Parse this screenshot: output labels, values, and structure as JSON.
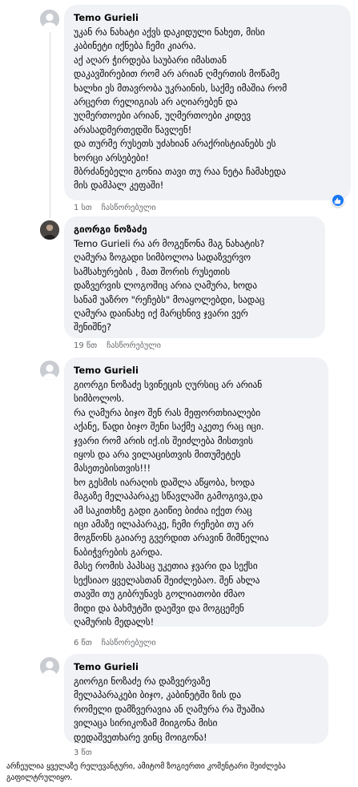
{
  "comments": [
    {
      "author": "Temo Gurieli",
      "text": "უკან რა ნახატი აქვს დაკიდული ნახეთ, მისი\nკაბინეტი იქნება ჩემი კიარა.\nაქ აღარ ჭირდება საუბარი იმასთან\nდაკავშირებით რომ არ არიან ღმერთის მოწამე\nხალხი ეს მთავრობა უკრაინის, საქმე იმაშია რომ\nარცერთ რელიგიას არ აღიარებენ და\nუღმერთოები არიან, უღმერთოები კიდევ\nარასადმერთედში წავლენ!\nდა თურმე რუსეთს უძახიან არაქრისტიანებს ეს\nხორცი არსებები!\nმბრძანებელი გონია თავი თუ რაა ნეტა ჩამახედა\nმის დამპალ კეფაში!",
      "time": "1 სთ",
      "reply": "ჩასწორებული",
      "liked": true
    },
    {
      "author": "გიორგი ნოზაძე",
      "text": "Temo Gurieli რა არ მოგეწონა მაგ ნახატის?\nღამურა ზოგადი სიმბოლოა სადაზვერვო\nსამსახურების , მათ შორის რუსეთის\nდაზვერვის ლოგოშიც არია ღამურა, ხოდა\nსანამ უაზრო \"რეჩებს\" მოაყოლებდი, სადაც\nღამურა დაინახე იქ მარცხნივ ჯვარი ვერ\nშენიშნე?",
      "time": "19 წთ",
      "reply": "ჩასწორებული"
    },
    {
      "author": "Temo Gurieli",
      "text": "გიორგი ნოზაძე სვინეცის ღურსიც არ არიან\nსიმბოლოს.\nრა ღამურა ბიჯო შენ რას მეფორთხიალები\nაქანე, წადი ბიჯო შენი საქმე აკეთე რაც იცი.\nჯვარი რომ არის იქ.ის შეიძლება მისთვის\nიყოს და არა ვილაცისთვის მითუმეტეს\nმასეთებისთვის!!!\nხო გესმის იარაღის დაშლა აწყობა, ხოდა\nმაგაზე მელაპარაკე სწავლაში გამოგივა,და\nამ საკითხზე გადი გაიწიე ბიძია იქეთ რაც\nიცი ამაზე ილაპარაკე, ჩემი რეჩები თუ არ\nმოგწონს გაიარე გვერდით არავინ მიმნელია\nნაბიჭვრების გარდა.\nმასე რომის პაპსაც უკეთია ჯვარი და სექსი\nსექსიაო ყველასთან შეიძლებაო. შენ ახლა\nთავში თუ გიბრუნავს გოლიათობი ძმაო\nმიდი და ბახმუტში დაეშვი და მოგცემენ\nღამურის მედალს!",
      "time": "6 წთ",
      "reply": "ჩასწორებული"
    },
    {
      "author": "Temo Gurieli",
      "text": "გიორგი ნოზაძე რა დაზვერვაზე\nმელაპარაკები ბიჯო, კაბინეტში ზის და\nრომელი დამზვერავია ან ღამურა რა შუაშია\nვილაცა სირიკოზამ მიიგონა მისი\nდედაშვეთხარე ვინც მოიგონა!",
      "time": "3 წთ"
    }
  ],
  "footer_note": "არჩეულია ყველაზე რელევანტური, ამიტომ ზოგიერთი კომენტარი შეიძლება გაფილტრულიყო.",
  "colors": {
    "bubble": "#f0f2f5",
    "meta": "#65676b",
    "like": "#1877f2"
  },
  "icons": [
    "avatar-silhouette-icon",
    "user-photo-avatar",
    "like-icon"
  ]
}
